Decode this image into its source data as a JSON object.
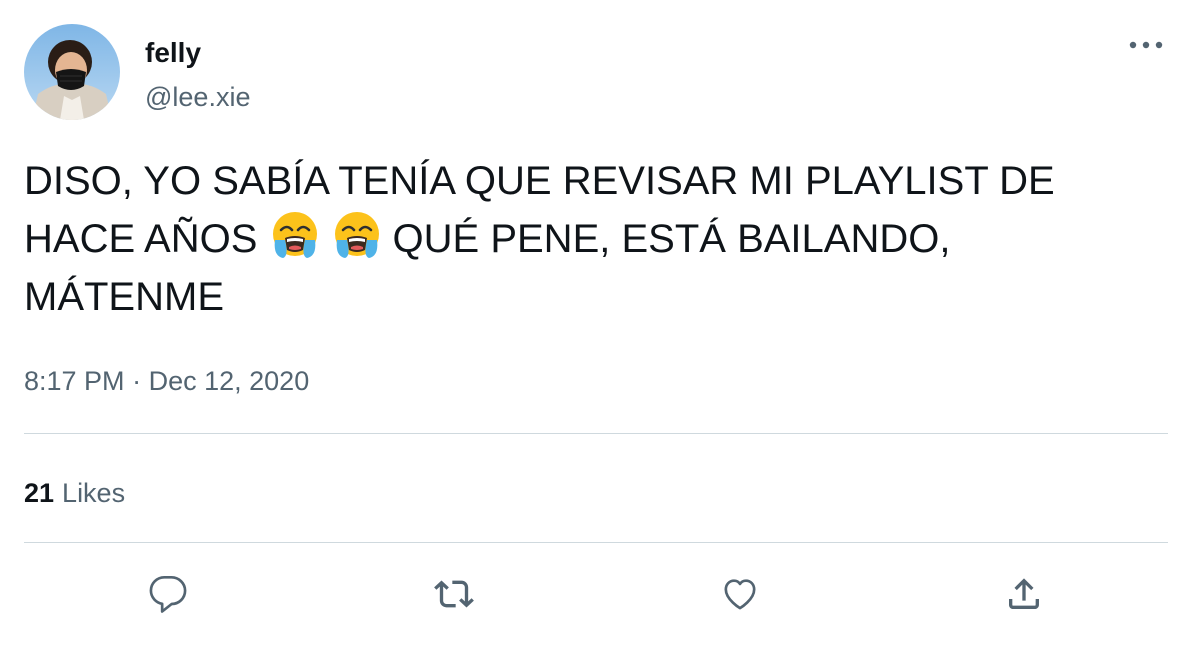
{
  "author": {
    "display_name": "felly",
    "handle": "@lee.xie",
    "avatar_icon": "profile-photo"
  },
  "tweet": {
    "line1": "DISO, YO SABÍA TENÍA QUE REVISAR MI PLAYLIST DE",
    "line2_before": "HACE AÑOS",
    "line2_emoji": [
      "loudly-crying-face",
      "loudly-crying-face"
    ],
    "line2_after": "QUÉ PENE, ESTÁ BAILANDO,",
    "line3": "MÁTENME",
    "time": "8:17 PM",
    "separator": "·",
    "date": "Dec 12, 2020"
  },
  "stats": {
    "likes_count": "21",
    "likes_label": "Likes"
  },
  "actions": [
    {
      "name": "reply",
      "icon": "speech-bubble-icon"
    },
    {
      "name": "retweet",
      "icon": "retweet-arrows-icon"
    },
    {
      "name": "like",
      "icon": "heart-icon"
    },
    {
      "name": "share",
      "icon": "share-upload-icon"
    }
  ],
  "colors": {
    "primary_text": "#0f1419",
    "secondary_text": "#536471",
    "divider": "#cfd9de"
  }
}
